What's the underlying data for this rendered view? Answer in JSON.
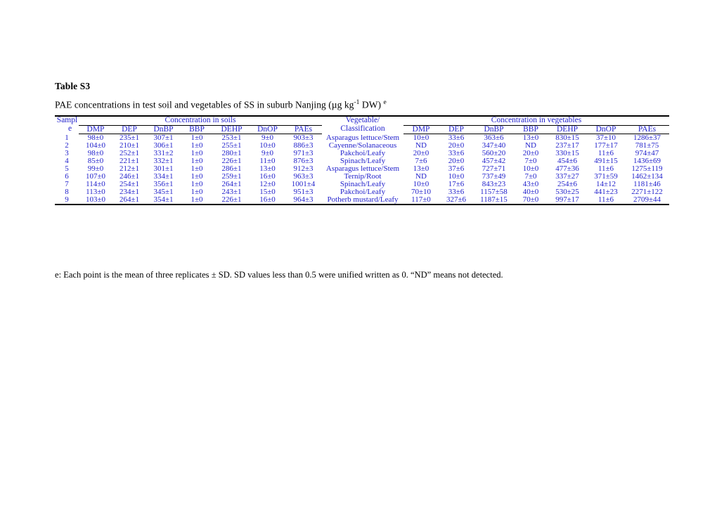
{
  "document": {
    "table_label": "Table S3",
    "caption_main": "PAE concentrations in test soil and vegetables of SS in suburb Nanjing (µg kg",
    "caption_sup": "-1",
    "caption_tail": " DW) ",
    "caption_tail_sup": "e",
    "footnote": "e: Each point is the mean of three replicates ± SD. SD values less than 0.5 were unified written as 0. “ND” means not detected.",
    "text_color": "#2222cc",
    "rule_color": "#000000"
  },
  "table": {
    "header": {
      "sample_line1": "Sampl",
      "sample_line2": "e",
      "group_soils": "Concentration in soils",
      "veg_line1": "Vegetable/",
      "veg_line2": "Classification",
      "group_vegetables": "Concentration in vegetables",
      "analytes": [
        "DMP",
        "DEP",
        "DnBP",
        "BBP",
        "DEHP",
        "DnOP",
        "PAEs"
      ]
    },
    "rows": [
      {
        "sample": "1",
        "soil": [
          "98±0",
          "235±1",
          "307±1",
          "1±0",
          "253±1",
          "9±0",
          "903±3"
        ],
        "vegetable": "Asparagus lettuce/Stem",
        "veg": [
          "10±0",
          "33±6",
          "363±6",
          "13±0",
          "830±15",
          "37±10",
          "1286±37"
        ]
      },
      {
        "sample": "2",
        "soil": [
          "104±0",
          "210±1",
          "306±1",
          "1±0",
          "255±1",
          "10±0",
          "886±3"
        ],
        "vegetable": "Cayenne/Solanaceous",
        "veg": [
          "ND",
          "20±0",
          "347±40",
          "ND",
          "237±17",
          "177±17",
          "781±75"
        ]
      },
      {
        "sample": "3",
        "soil": [
          "98±0",
          "252±1",
          "331±2",
          "1±0",
          "280±1",
          "9±0",
          "971±3"
        ],
        "vegetable": "Pakchoi/Leafy",
        "veg": [
          "20±0",
          "33±6",
          "560±20",
          "20±0",
          "330±15",
          "11±6",
          "974±47"
        ]
      },
      {
        "sample": "4",
        "soil": [
          "85±0",
          "221±1",
          "332±1",
          "1±0",
          "226±1",
          "11±0",
          "876±3"
        ],
        "vegetable": "Spinach/Leafy",
        "veg": [
          "7±6",
          "20±0",
          "457±42",
          "7±0",
          "454±6",
          "491±15",
          "1436±69"
        ]
      },
      {
        "sample": "5",
        "soil": [
          "99±0",
          "212±1",
          "301±1",
          "1±0",
          "286±1",
          "13±0",
          "912±3"
        ],
        "vegetable": "Asparagus lettuce/Stem",
        "veg": [
          "13±0",
          "37±6",
          "727±71",
          "10±0",
          "477±36",
          "11±6",
          "1275±119"
        ]
      },
      {
        "sample": "6",
        "soil": [
          "107±0",
          "246±1",
          "334±1",
          "1±0",
          "259±1",
          "16±0",
          "963±3"
        ],
        "vegetable": "Ternip/Root",
        "veg": [
          "ND",
          "10±0",
          "737±49",
          "7±0",
          "337±27",
          "371±59",
          "1462±134"
        ]
      },
      {
        "sample": "7",
        "soil": [
          "114±0",
          "254±1",
          "356±1",
          "1±0",
          "264±1",
          "12±0",
          "1001±4"
        ],
        "vegetable": "Spinach/Leafy",
        "veg": [
          "10±0",
          "17±6",
          "843±23",
          "43±0",
          "254±6",
          "14±12",
          "1181±46"
        ]
      },
      {
        "sample": "8",
        "soil": [
          "113±0",
          "234±1",
          "345±1",
          "1±0",
          "243±1",
          "15±0",
          "951±3"
        ],
        "vegetable": "Pakchoi/Leafy",
        "veg": [
          "70±10",
          "33±6",
          "1157±58",
          "40±0",
          "530±25",
          "441±23",
          "2271±122"
        ]
      },
      {
        "sample": "9",
        "soil": [
          "103±0",
          "264±1",
          "354±1",
          "1±0",
          "226±1",
          "16±0",
          "964±3"
        ],
        "vegetable": "Potherb mustard/Leafy",
        "veg": [
          "117±0",
          "327±6",
          "1187±15",
          "70±0",
          "997±17",
          "11±6",
          "2709±44"
        ]
      }
    ]
  }
}
